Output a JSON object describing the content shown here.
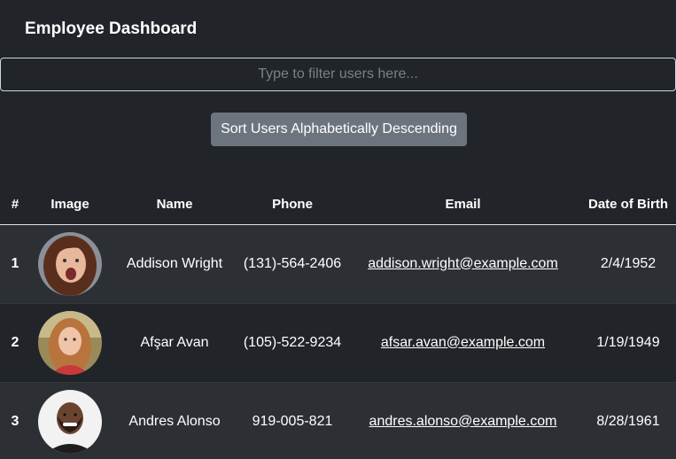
{
  "header": {
    "title": "Employee Dashboard"
  },
  "filter": {
    "placeholder": "Type to filter users here...",
    "value": ""
  },
  "sort_button": {
    "label": "Sort Users Alphabetically Descending"
  },
  "table": {
    "columns": [
      "#",
      "Image",
      "Name",
      "Phone",
      "Email",
      "Date of Birth"
    ],
    "rows": [
      {
        "num": "1",
        "name": "Addison Wright",
        "phone": "(131)-564-2406",
        "email": "addison.wright@example.com",
        "dob": "2/4/1952"
      },
      {
        "num": "2",
        "name": "Afşar Avan",
        "phone": "(105)-522-9234",
        "email": "afsar.avan@example.com",
        "dob": "1/19/1949"
      },
      {
        "num": "3",
        "name": "Andres Alonso",
        "phone": "919-005-821",
        "email": "andres.alonso@example.com",
        "dob": "8/28/1961"
      }
    ]
  },
  "colors": {
    "background": "#212529",
    "striped_row": "#2c3034",
    "button": "#6c757d",
    "text": "#ffffff"
  }
}
